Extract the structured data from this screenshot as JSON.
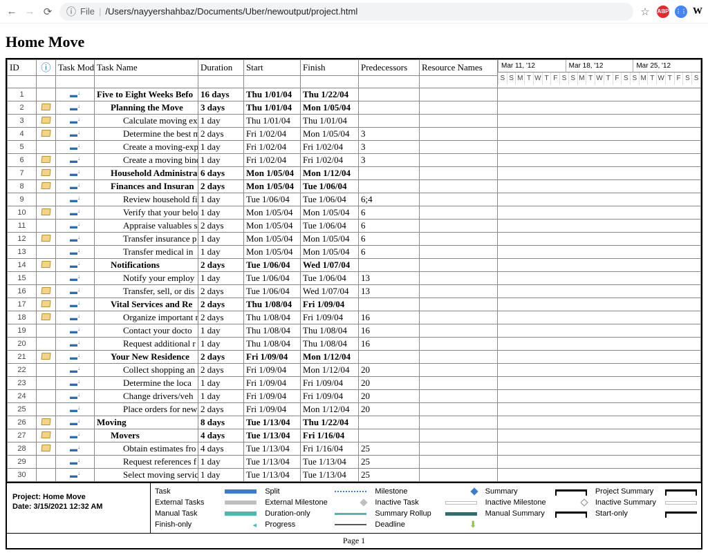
{
  "browser": {
    "url_file_label": "File",
    "url_path": "/Users/nayyershahbaz/Documents/Uber/newoutput/project.html"
  },
  "title": "Home Move",
  "columns": [
    "ID",
    "",
    "Task Mode",
    "Task Name",
    "Duration",
    "Start",
    "Finish",
    "Predecessors",
    "Resource Names"
  ],
  "info_icon": "ⓘ",
  "timeline_weeks": [
    "Mar 11, '12",
    "Mar 18, '12",
    "Mar 25, '12"
  ],
  "timeline_days": [
    "S",
    "S",
    "M",
    "T",
    "W",
    "T",
    "F",
    "S",
    "S",
    "M",
    "T",
    "W",
    "T",
    "F",
    "S",
    "S",
    "M",
    "T",
    "W",
    "T",
    "F",
    "S",
    "S"
  ],
  "rows": [
    {
      "id": "1",
      "note": false,
      "bold": true,
      "indent": 0,
      "name": "Five to Eight Weeks Befo",
      "dur": "16 days",
      "start": "Thu 1/01/04",
      "fin": "Thu 1/22/04",
      "pred": ""
    },
    {
      "id": "2",
      "note": true,
      "bold": true,
      "indent": 1,
      "name": "Planning the Move",
      "dur": "3 days",
      "start": "Thu 1/01/04",
      "fin": "Mon 1/05/04",
      "pred": ""
    },
    {
      "id": "3",
      "note": true,
      "bold": false,
      "indent": 2,
      "name": "Calculate moving exp",
      "dur": "1 day",
      "start": "Thu 1/01/04",
      "fin": "Thu 1/01/04",
      "pred": ""
    },
    {
      "id": "4",
      "note": true,
      "bold": false,
      "indent": 2,
      "name": "Determine the best m",
      "dur": "2 days",
      "start": "Fri 1/02/04",
      "fin": "Mon 1/05/04",
      "pred": "3"
    },
    {
      "id": "5",
      "note": false,
      "bold": false,
      "indent": 2,
      "name": "Create a moving-expe",
      "dur": "1 day",
      "start": "Fri 1/02/04",
      "fin": "Fri 1/02/04",
      "pred": "3"
    },
    {
      "id": "6",
      "note": true,
      "bold": false,
      "indent": 2,
      "name": "Create a moving bind",
      "dur": "1 day",
      "start": "Fri 1/02/04",
      "fin": "Fri 1/02/04",
      "pred": "3"
    },
    {
      "id": "7",
      "note": true,
      "bold": true,
      "indent": 1,
      "name": "Household Administratio",
      "dur": "6 days",
      "start": "Mon 1/05/04",
      "fin": "Mon 1/12/04",
      "pred": ""
    },
    {
      "id": "8",
      "note": true,
      "bold": true,
      "indent": 1,
      "name": "Finances and Insuran",
      "dur": "2 days",
      "start": "Mon 1/05/04",
      "fin": "Tue 1/06/04",
      "pred": ""
    },
    {
      "id": "9",
      "note": false,
      "bold": false,
      "indent": 2,
      "name": "Review household fin",
      "dur": "1 day",
      "start": "Tue 1/06/04",
      "fin": "Tue 1/06/04",
      "pred": "6;4"
    },
    {
      "id": "10",
      "note": true,
      "bold": false,
      "indent": 2,
      "name": "Verify that your belo",
      "dur": "1 day",
      "start": "Mon 1/05/04",
      "fin": "Mon 1/05/04",
      "pred": "6"
    },
    {
      "id": "11",
      "note": false,
      "bold": false,
      "indent": 2,
      "name": "Appraise valuables s",
      "dur": "2 days",
      "start": "Mon 1/05/04",
      "fin": "Tue 1/06/04",
      "pred": "6"
    },
    {
      "id": "12",
      "note": true,
      "bold": false,
      "indent": 2,
      "name": "Transfer insurance p",
      "dur": "1 day",
      "start": "Mon 1/05/04",
      "fin": "Mon 1/05/04",
      "pred": "6"
    },
    {
      "id": "13",
      "note": false,
      "bold": false,
      "indent": 2,
      "name": "Transfer medical in",
      "dur": "1 day",
      "start": "Mon 1/05/04",
      "fin": "Mon 1/05/04",
      "pred": "6"
    },
    {
      "id": "14",
      "note": true,
      "bold": true,
      "indent": 1,
      "name": "Notifications",
      "dur": "2 days",
      "start": "Tue 1/06/04",
      "fin": "Wed 1/07/04",
      "pred": ""
    },
    {
      "id": "15",
      "note": false,
      "bold": false,
      "indent": 2,
      "name": "Notify your employ",
      "dur": "1 day",
      "start": "Tue 1/06/04",
      "fin": "Tue 1/06/04",
      "pred": "13"
    },
    {
      "id": "16",
      "note": true,
      "bold": false,
      "indent": 2,
      "name": "Transfer, sell, or dis",
      "dur": "2 days",
      "start": "Tue 1/06/04",
      "fin": "Wed 1/07/04",
      "pred": "13"
    },
    {
      "id": "17",
      "note": true,
      "bold": true,
      "indent": 1,
      "name": "Vital Services and Re",
      "dur": "2 days",
      "start": "Thu 1/08/04",
      "fin": "Fri 1/09/04",
      "pred": ""
    },
    {
      "id": "18",
      "note": true,
      "bold": false,
      "indent": 2,
      "name": "Organize important r",
      "dur": "2 days",
      "start": "Thu 1/08/04",
      "fin": "Fri 1/09/04",
      "pred": "16"
    },
    {
      "id": "19",
      "note": false,
      "bold": false,
      "indent": 2,
      "name": "Contact your docto",
      "dur": "1 day",
      "start": "Thu 1/08/04",
      "fin": "Thu 1/08/04",
      "pred": "16"
    },
    {
      "id": "20",
      "note": false,
      "bold": false,
      "indent": 2,
      "name": "Request additional r",
      "dur": "1 day",
      "start": "Thu 1/08/04",
      "fin": "Thu 1/08/04",
      "pred": "16"
    },
    {
      "id": "21",
      "note": true,
      "bold": true,
      "indent": 1,
      "name": "Your New Residence",
      "dur": "2 days",
      "start": "Fri 1/09/04",
      "fin": "Mon 1/12/04",
      "pred": ""
    },
    {
      "id": "22",
      "note": false,
      "bold": false,
      "indent": 2,
      "name": "Collect shopping an",
      "dur": "2 days",
      "start": "Fri 1/09/04",
      "fin": "Mon 1/12/04",
      "pred": "20"
    },
    {
      "id": "23",
      "note": false,
      "bold": false,
      "indent": 2,
      "name": "Determine the loca",
      "dur": "1 day",
      "start": "Fri 1/09/04",
      "fin": "Fri 1/09/04",
      "pred": "20"
    },
    {
      "id": "24",
      "note": false,
      "bold": false,
      "indent": 2,
      "name": "Change drivers/veh",
      "dur": "1 day",
      "start": "Fri 1/09/04",
      "fin": "Fri 1/09/04",
      "pred": "20"
    },
    {
      "id": "25",
      "note": false,
      "bold": false,
      "indent": 2,
      "name": "Place orders for new",
      "dur": "2 days",
      "start": "Fri 1/09/04",
      "fin": "Mon 1/12/04",
      "pred": "20"
    },
    {
      "id": "26",
      "note": true,
      "bold": true,
      "indent": 0,
      "name": "Moving",
      "dur": "8 days",
      "start": "Tue 1/13/04",
      "fin": "Thu 1/22/04",
      "pred": ""
    },
    {
      "id": "27",
      "note": true,
      "bold": true,
      "indent": 1,
      "name": "Movers",
      "dur": "4 days",
      "start": "Tue 1/13/04",
      "fin": "Fri 1/16/04",
      "pred": ""
    },
    {
      "id": "28",
      "note": true,
      "bold": false,
      "indent": 2,
      "name": "Obtain estimates fro",
      "dur": "4 days",
      "start": "Tue 1/13/04",
      "fin": "Fri 1/16/04",
      "pred": "25"
    },
    {
      "id": "29",
      "note": false,
      "bold": false,
      "indent": 2,
      "name": "Request references f",
      "dur": "1 day",
      "start": "Tue 1/13/04",
      "fin": "Tue 1/13/04",
      "pred": "25"
    },
    {
      "id": "30",
      "note": false,
      "bold": false,
      "indent": 2,
      "name": "Select moving servic",
      "dur": "1 day",
      "start": "Tue 1/13/04",
      "fin": "Tue 1/13/04",
      "pred": "25"
    }
  ],
  "legend_meta": {
    "project": "Project: Home Move",
    "date": "Date: 3/15/2021 12:32 AM"
  },
  "legend": {
    "c1": [
      "Task",
      "External Tasks",
      "Manual Task",
      "Finish-only"
    ],
    "c2": [
      "Split",
      "External Milestone",
      "Duration-only",
      "Progress"
    ],
    "c3": [
      "Milestone",
      "Inactive Task",
      "Summary Rollup",
      "Deadline"
    ],
    "c4": [
      "Summary",
      "Inactive Milestone",
      "Manual Summary",
      ""
    ],
    "c5": [
      "Project Summary",
      "Inactive Summary",
      "Start-only",
      ""
    ]
  },
  "footer": "Page 1"
}
